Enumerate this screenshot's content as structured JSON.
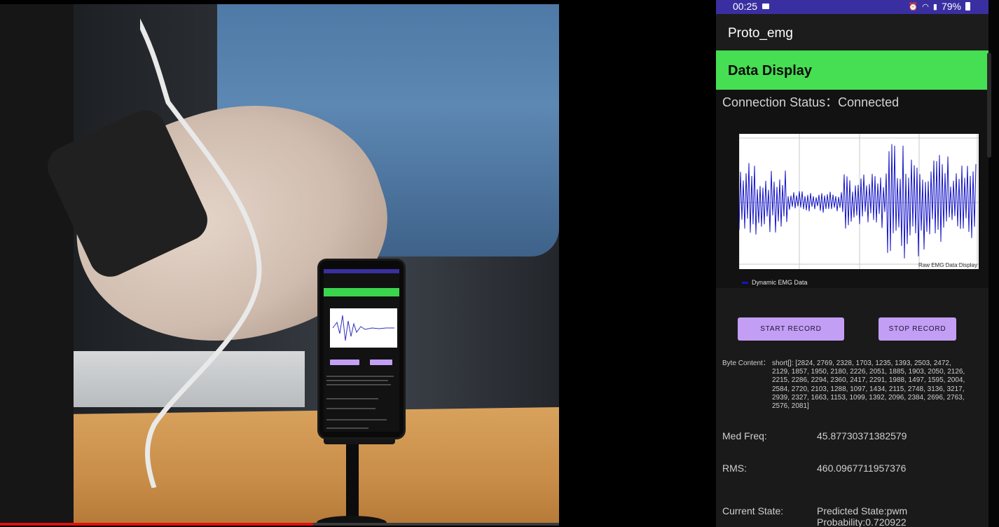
{
  "video_progress": 0.56,
  "phone": {
    "status_bar": {
      "time": "00:25",
      "battery": "79%",
      "icons": [
        "screen-record-icon",
        "alarm-icon",
        "wifi-icon",
        "lte-icon",
        "signal-icon",
        "battery-icon"
      ]
    },
    "app_title": "Proto_emg",
    "section_title": "Data Display",
    "connection_status": "Connection Status：Connected",
    "chart_description": "Raw EMG Data Display",
    "legend_label": "Dynamic EMG Data",
    "buttons": {
      "start_record": "START RECORD",
      "stop_record": "STOP RECORD"
    },
    "byte_content_label": "Byte Content：",
    "byte_content": "short[]: [2824, 2769, 2328, 1703, 1235, 1393, 2503, 2472, 2129, 1857, 1950, 2180, 2226, 2051, 1885, 1903, 2050, 2126, 2215, 2286, 2294, 2360, 2417, 2291, 1988, 1497, 1595, 2004, 2584, 2720, 2103, 1288, 1097, 1434, 2115, 2748, 3136, 3217, 2939, 2327, 1663, 1153, 1099, 1392, 2096, 2384, 2696, 2763, 2576, 2081]",
    "med_freq_label": "Med Freq:",
    "med_freq_value": "45.87730371382579",
    "rms_label": "RMS:",
    "rms_value": "460.0967711957376",
    "current_state_label": "Current State:",
    "current_state_value": "Predicted State:pwm",
    "probability": "Probability:0.720922"
  },
  "colors": {
    "status_bar": "#3a2fa0",
    "header_green": "#46de52",
    "button_purple": "#c39ef5",
    "series_blue": "#1414c8",
    "progress_red": "#e01010"
  },
  "chart_data": {
    "type": "line",
    "description": "Raw EMG Data Display",
    "series": [
      {
        "name": "Dynamic EMG Data"
      }
    ],
    "grid": true,
    "legend": "bottom-left",
    "x_ticks": [],
    "y_ticks": []
  }
}
